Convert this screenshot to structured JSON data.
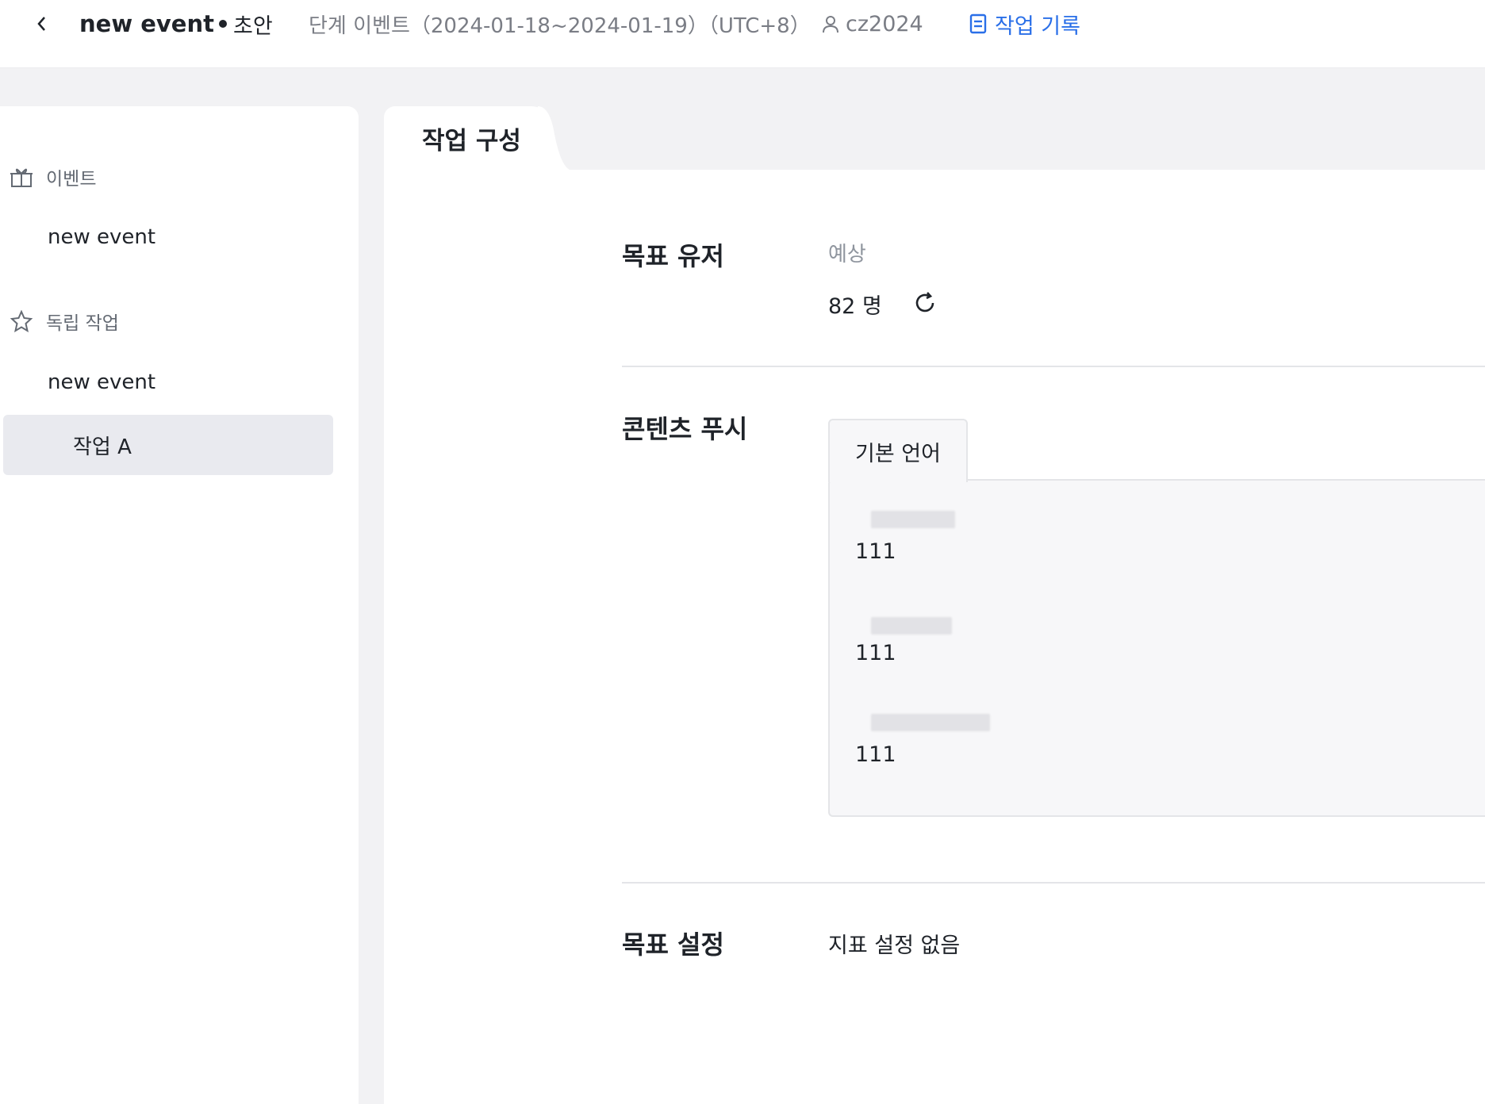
{
  "header": {
    "back_label": "‹",
    "title": "new event",
    "status": "초안",
    "stage": "단계 이벤트（2024-01-18~2024-01-19）（UTC+8）",
    "owner": "cz2024",
    "log_label": "작업 기록",
    "log_color": "#2a6fe8"
  },
  "sidebar": {
    "section_event": "이벤트",
    "event_item": "new event",
    "section_task": "독립 작업",
    "task_group": "new event",
    "task_item": "작업 A"
  },
  "main": {
    "tab_label": "작업 구성",
    "target_users": {
      "label": "목표 유저",
      "estimate_label": "예상",
      "estimate_value": "82 명"
    },
    "content_push": {
      "label": "콘텐츠 푸시",
      "language_tab": "기본 언어",
      "items": [
        {
          "value": "111"
        },
        {
          "value": "111"
        },
        {
          "value": "111"
        }
      ]
    },
    "goal_setting": {
      "label": "목표 설정",
      "value": "지표 설정 없음"
    }
  }
}
